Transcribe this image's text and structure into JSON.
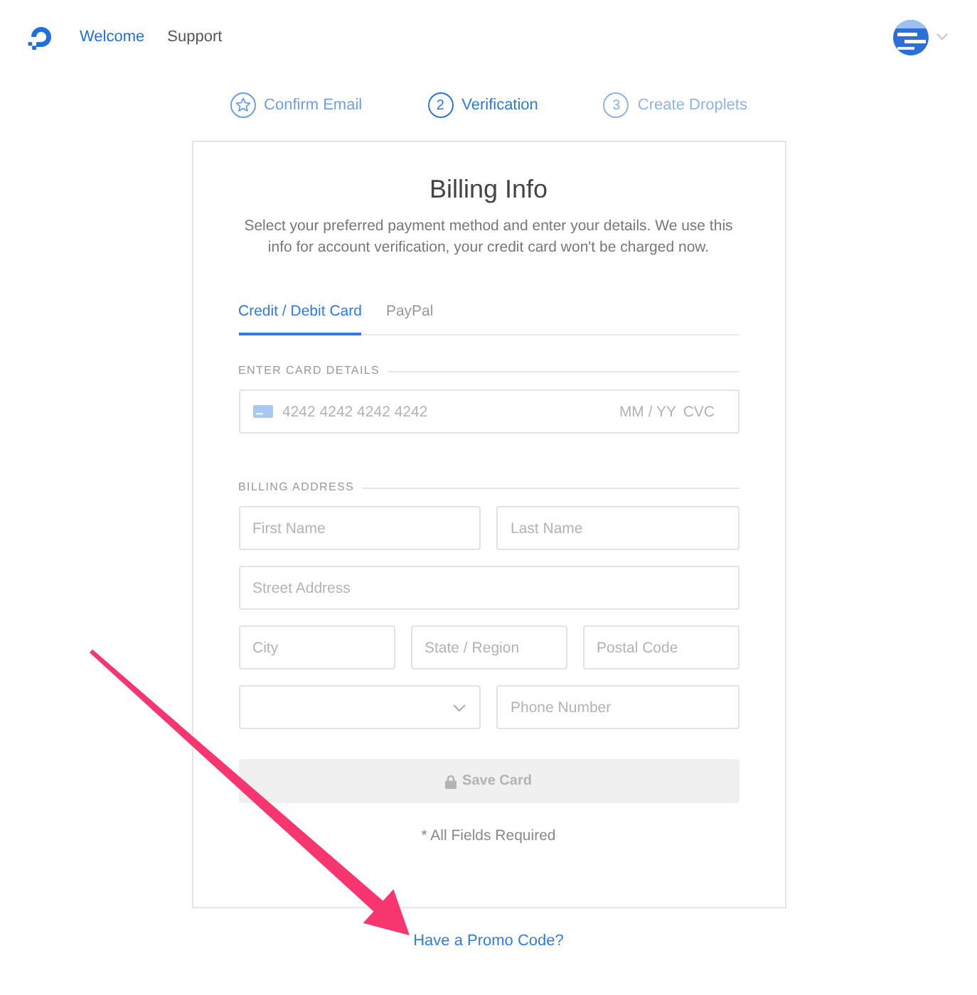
{
  "header": {
    "nav": [
      {
        "label": "Welcome",
        "selected": true
      },
      {
        "label": "Support",
        "selected": false
      }
    ]
  },
  "steps": [
    {
      "label": "Confirm Email",
      "completed": true,
      "selected": false
    },
    {
      "number": "2",
      "label": "Verification",
      "completed": false,
      "selected": true
    },
    {
      "number": "3",
      "label": "Create Droplets",
      "completed": false,
      "selected": false
    }
  ],
  "card": {
    "title": "Billing Info",
    "description": "Select your preferred payment method and enter your details. We use this\ninfo for account verification, your credit card won't be charged now.",
    "tabs": [
      {
        "label": "Credit / Debit Card",
        "selected": true
      },
      {
        "label": "PayPal",
        "selected": false
      }
    ],
    "card_details": {
      "heading": "ENTER CARD DETAILS",
      "number_placeholder": "4242 4242 4242 4242",
      "expiry_placeholder": "MM / YY",
      "cvc_placeholder": "CVC"
    },
    "billing_address": {
      "heading": "BILLING ADDRESS",
      "rows": [
        [
          {
            "kind": "text",
            "placeholder": "First Name"
          },
          {
            "kind": "text",
            "placeholder": "Last Name"
          }
        ],
        [
          {
            "kind": "text",
            "placeholder": "Street Address"
          }
        ],
        [
          {
            "kind": "text",
            "placeholder": "City"
          },
          {
            "kind": "text",
            "placeholder": "State / Region"
          },
          {
            "kind": "text",
            "placeholder": "Postal Code"
          }
        ],
        [
          {
            "kind": "select"
          },
          {
            "kind": "text",
            "placeholder": "Phone Number"
          }
        ]
      ]
    },
    "save_button": {
      "label": "Save Card",
      "disabled": true
    },
    "note": "* All Fields Required"
  },
  "promo_link": "Have a Promo Code?"
}
